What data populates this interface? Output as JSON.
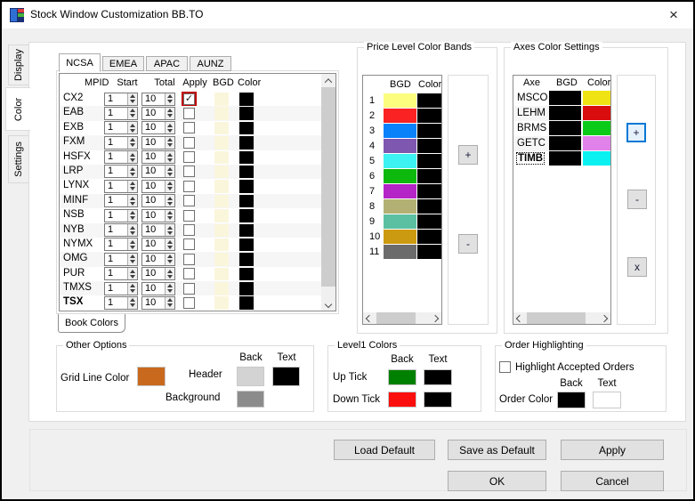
{
  "window": {
    "title": "Stock Window Customization BB.TO",
    "close_glyph": "×"
  },
  "side_tabs": [
    {
      "label": "Display",
      "selected": false
    },
    {
      "label": "Color",
      "selected": true
    },
    {
      "label": "Settings",
      "selected": false
    }
  ],
  "book": {
    "tabs": [
      {
        "label": "NCSA",
        "selected": true
      },
      {
        "label": "EMEA",
        "selected": false
      },
      {
        "label": "APAC",
        "selected": false
      },
      {
        "label": "AUNZ",
        "selected": false
      }
    ],
    "columns": [
      "MPID",
      "Start",
      "Total",
      "Apply",
      "BGD",
      "Color"
    ],
    "rows": [
      {
        "mpid": "CX2",
        "start": "1",
        "total": "10",
        "apply": true,
        "focused": true,
        "bold": false,
        "bgd": "#FAF6DC",
        "color": "#000000"
      },
      {
        "mpid": "EAB",
        "start": "1",
        "total": "10",
        "apply": false,
        "focused": false,
        "bold": false,
        "bgd": "#FAF6DC",
        "color": "#000000"
      },
      {
        "mpid": "EXB",
        "start": "1",
        "total": "10",
        "apply": false,
        "focused": false,
        "bold": false,
        "bgd": "#FAF6DC",
        "color": "#000000"
      },
      {
        "mpid": "FXM",
        "start": "1",
        "total": "10",
        "apply": false,
        "focused": false,
        "bold": false,
        "bgd": "#FAF6DC",
        "color": "#000000"
      },
      {
        "mpid": "HSFX",
        "start": "1",
        "total": "10",
        "apply": false,
        "focused": false,
        "bold": false,
        "bgd": "#FAF6DC",
        "color": "#000000"
      },
      {
        "mpid": "LRP",
        "start": "1",
        "total": "10",
        "apply": false,
        "focused": false,
        "bold": false,
        "bgd": "#FAF6DC",
        "color": "#000000"
      },
      {
        "mpid": "LYNX",
        "start": "1",
        "total": "10",
        "apply": false,
        "focused": false,
        "bold": false,
        "bgd": "#FAF6DC",
        "color": "#000000"
      },
      {
        "mpid": "MINF",
        "start": "1",
        "total": "10",
        "apply": false,
        "focused": false,
        "bold": false,
        "bgd": "#FAF6DC",
        "color": "#000000"
      },
      {
        "mpid": "NSB",
        "start": "1",
        "total": "10",
        "apply": false,
        "focused": false,
        "bold": false,
        "bgd": "#FAF6DC",
        "color": "#000000"
      },
      {
        "mpid": "NYB",
        "start": "1",
        "total": "10",
        "apply": false,
        "focused": false,
        "bold": false,
        "bgd": "#FAF6DC",
        "color": "#000000"
      },
      {
        "mpid": "NYMX",
        "start": "1",
        "total": "10",
        "apply": false,
        "focused": false,
        "bold": false,
        "bgd": "#FAF6DC",
        "color": "#000000"
      },
      {
        "mpid": "OMG",
        "start": "1",
        "total": "10",
        "apply": false,
        "focused": false,
        "bold": false,
        "bgd": "#FAF6DC",
        "color": "#000000"
      },
      {
        "mpid": "PUR",
        "start": "1",
        "total": "10",
        "apply": false,
        "focused": false,
        "bold": false,
        "bgd": "#FAF6DC",
        "color": "#000000"
      },
      {
        "mpid": "TMXS",
        "start": "1",
        "total": "10",
        "apply": false,
        "focused": false,
        "bold": false,
        "bgd": "#FAF6DC",
        "color": "#000000"
      },
      {
        "mpid": "TSX",
        "start": "1",
        "total": "10",
        "apply": false,
        "focused": false,
        "bold": true,
        "bgd": "#FAF6DC",
        "color": "#000000"
      }
    ],
    "bottom_tab_label": "Book Colors"
  },
  "price_bands": {
    "title": "Price Level Color Bands",
    "columns": [
      "BGD",
      "Color"
    ],
    "rows": [
      {
        "num": "1",
        "bgd": "#FCFC7E",
        "color": "#000000"
      },
      {
        "num": "2",
        "bgd": "#FA2222",
        "color": "#000000"
      },
      {
        "num": "3",
        "bgd": "#0A82FA",
        "color": "#000000"
      },
      {
        "num": "4",
        "bgd": "#7E57B0",
        "color": "#000000"
      },
      {
        "num": "5",
        "bgd": "#3DF2F2",
        "color": "#000000"
      },
      {
        "num": "6",
        "bgd": "#0CB90C",
        "color": "#000000"
      },
      {
        "num": "7",
        "bgd": "#B524C6",
        "color": "#000000"
      },
      {
        "num": "8",
        "bgd": "#B2B173",
        "color": "#000000"
      },
      {
        "num": "9",
        "bgd": "#5BC0A2",
        "color": "#000000"
      },
      {
        "num": "10",
        "bgd": "#CC9A10",
        "color": "#000000"
      },
      {
        "num": "11",
        "bgd": "#6B6B6B",
        "color": "#000000"
      }
    ],
    "add_label": "+",
    "remove_label": "-"
  },
  "axes": {
    "title": "Axes Color Settings",
    "columns": [
      "Axe",
      "BGD",
      "Color"
    ],
    "rows": [
      {
        "axe": "MSCO",
        "bgd": "#000000",
        "color": "#F0E313",
        "bold": false,
        "focused": false
      },
      {
        "axe": "LEHM",
        "bgd": "#000000",
        "color": "#D90D0D",
        "bold": false,
        "focused": false
      },
      {
        "axe": "BRMS",
        "bgd": "#000000",
        "color": "#0BCB19",
        "bold": false,
        "focused": false
      },
      {
        "axe": "GETC",
        "bgd": "#000000",
        "color": "#E181EA",
        "bold": false,
        "focused": false
      },
      {
        "axe": "TIMB",
        "bgd": "#000000",
        "color": "#0BF1F1",
        "bold": true,
        "focused": true
      }
    ],
    "add_label": "+",
    "remove_label": "-",
    "delete_label": "x"
  },
  "other_options": {
    "title": "Other Options",
    "grid_line_label": "Grid Line Color",
    "grid_line_color": "#C8691E",
    "back_header": "Back",
    "text_header": "Text",
    "header_label": "Header",
    "header_back": "#D3D3D3",
    "header_text": "#000000",
    "background_label": "Background",
    "background_color": "#8C8C8C"
  },
  "level1": {
    "title": "Level1 Colors",
    "back_header": "Back",
    "text_header": "Text",
    "rows": [
      {
        "label": "Up Tick",
        "back": "#008000",
        "text": "#000000"
      },
      {
        "label": "Down Tick",
        "back": "#FB0E0E",
        "text": "#000000"
      }
    ]
  },
  "order": {
    "title": "Order Highlighting",
    "checkbox_label": "Highlight Accepted Orders",
    "checked": false,
    "back_header": "Back",
    "text_header": "Text",
    "order_color_label": "Order Color",
    "back": "#000000",
    "text": "#FFFFFF"
  },
  "actions": {
    "load_default": "Load Default",
    "save_as_default": "Save as Default",
    "apply": "Apply",
    "ok": "OK",
    "cancel": "Cancel"
  }
}
